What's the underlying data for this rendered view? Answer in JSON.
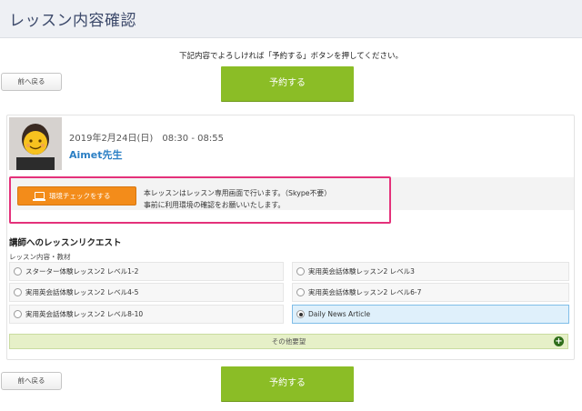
{
  "header": {
    "title": "レッスン内容確認"
  },
  "instruction": "下記内容でよろしければ「予約する」ボタンを押してください。",
  "nav": {
    "back_label": "前へ戻る",
    "reserve_label": "予約する"
  },
  "lesson": {
    "datetime": "2019年2月24日(日)　08:30 - 08:55",
    "teacher": "Aimet先生"
  },
  "environment": {
    "button_label": "環境チェックをする",
    "note_line1": "本レッスンはレッスン専用画面で行います。（Skype不要）",
    "note_line2": "事前に利用環境の確認をお願いいたします。"
  },
  "request": {
    "title": "講師へのレッスンリクエスト",
    "material_label": "レッスン内容・教材",
    "options": [
      "スターター体験レッスン2 レベル1-2",
      "実用英会話体験レッスン2 レベル3",
      "実用英会話体験レッスン2 レベル4-5",
      "実用英会話体験レッスン2 レベル6-7",
      "実用英会話体験レッスン2 レベル8-10",
      "Daily News Article"
    ],
    "selected_option": "Daily News Article",
    "other_label": "その他要望",
    "other_icon": "+"
  },
  "colors": {
    "accent_green": "#8bbd26",
    "orange": "#f38c1a",
    "highlight_pink": "#e4317a",
    "link_blue": "#2b7fc4"
  }
}
